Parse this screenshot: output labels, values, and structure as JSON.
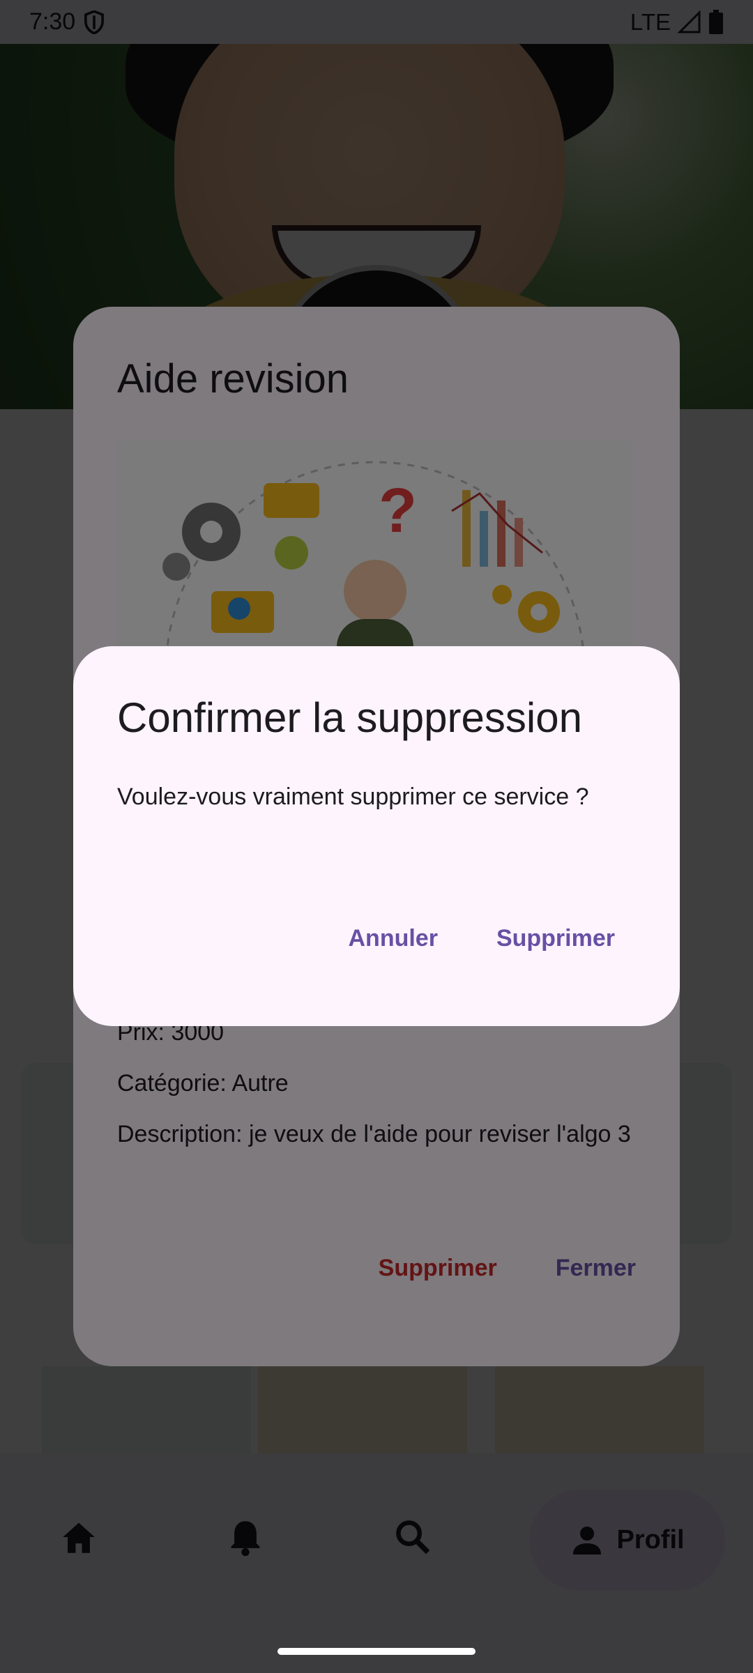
{
  "status_bar": {
    "time": "7:30",
    "network": "LTE"
  },
  "details_dialog": {
    "title": "Aide revision",
    "price_line": "Prix: 3000",
    "category_line": "Catégorie: Autre",
    "description_line": "Description: je veux de l'aide pour reviser l'algo 3",
    "delete_label": "Supprimer",
    "close_label": "Fermer"
  },
  "confirm_dialog": {
    "title": "Confirmer la suppression",
    "message": "Voulez-vous vraiment supprimer ce service ?",
    "cancel_label": "Annuler",
    "confirm_label": "Supprimer"
  },
  "bottom_nav": {
    "items": [
      {
        "icon": "home-icon"
      },
      {
        "icon": "bell-icon"
      },
      {
        "icon": "search-icon"
      }
    ],
    "profile_label": "Profil"
  },
  "colors": {
    "primary": "#6750a4",
    "danger": "#c62828",
    "dialog_bg": "#fdf4fd"
  }
}
